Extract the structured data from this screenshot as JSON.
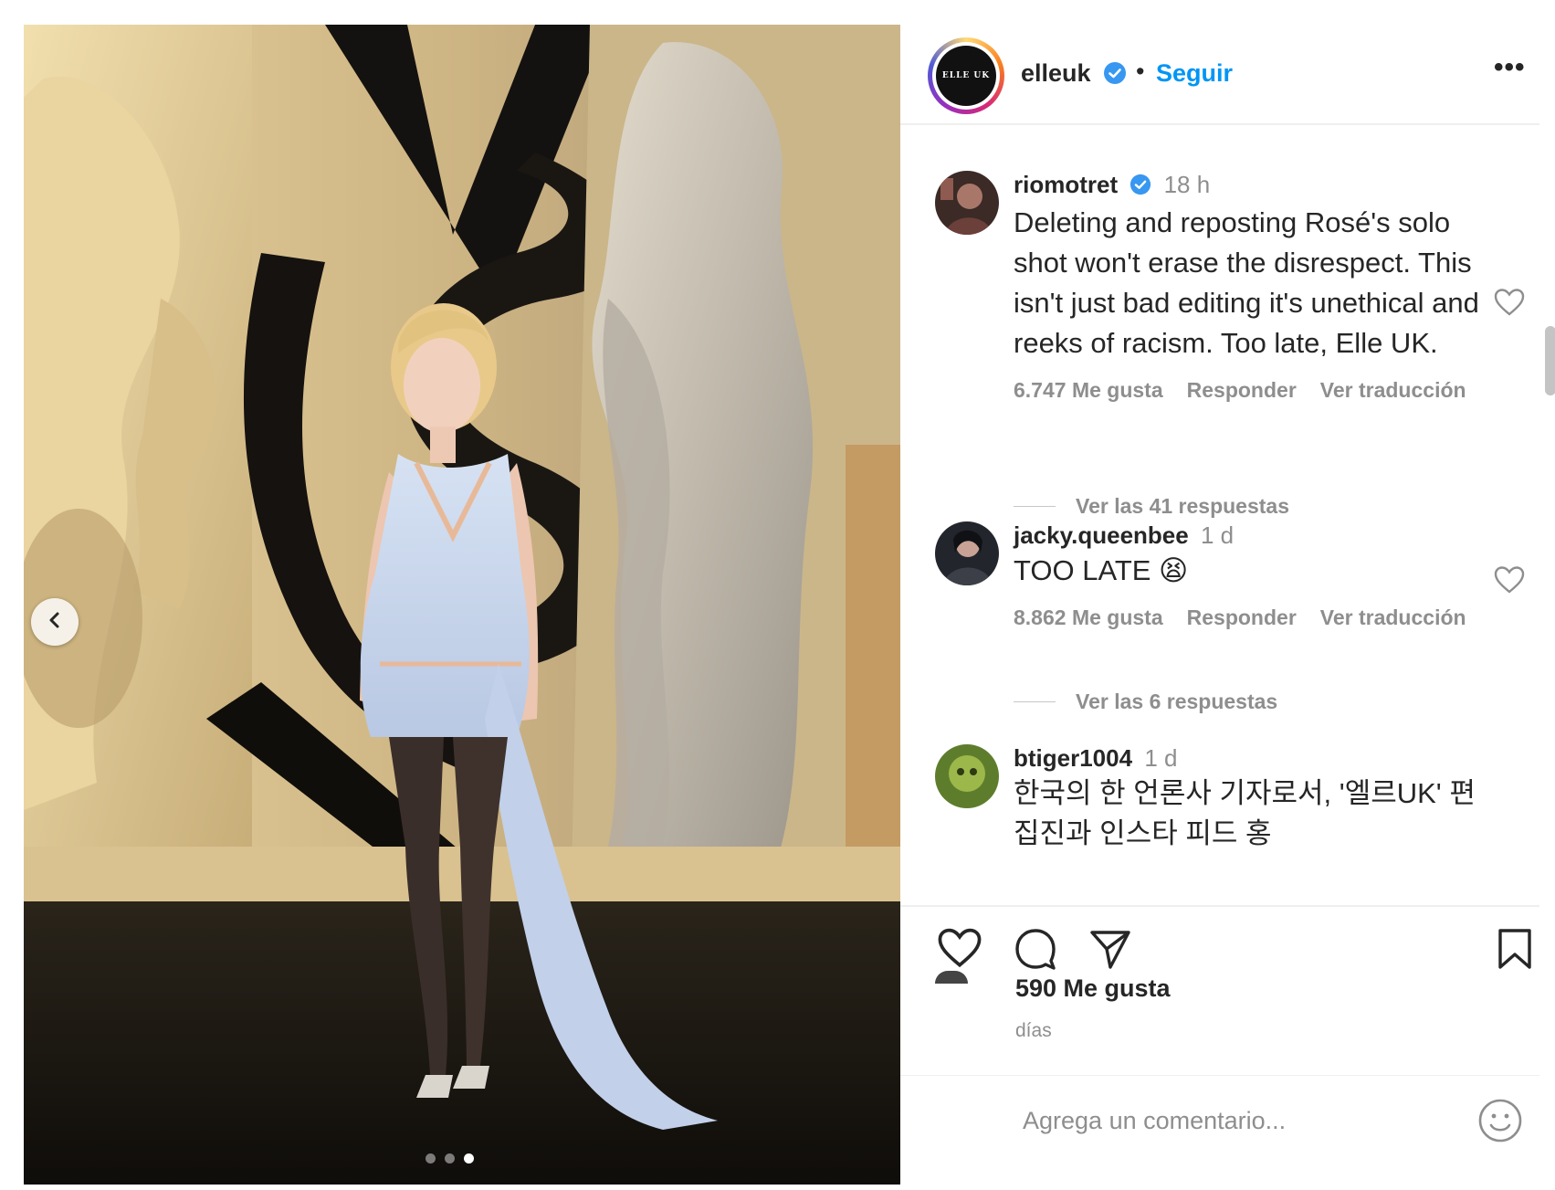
{
  "post": {
    "account": "elleuk",
    "avatar_text": "ELLE UK",
    "separator": "•",
    "follow_label": "Seguir",
    "more_label": "•••",
    "carousel": {
      "slide_count": 3,
      "active_index": 2
    }
  },
  "comments": [
    {
      "username": "riomotret",
      "verified": true,
      "time": "18 h",
      "text": "Deleting and reposting Rosé's solo shot won't erase the disrespect. This isn't just bad editing it's unethical and reeks of racism. Too late, Elle UK.",
      "likes": "6.747 Me gusta",
      "reply_label": "Responder",
      "translate_label": "Ver traducción",
      "view_replies": "Ver las 41 respuestas"
    },
    {
      "username": "jacky.queenbee",
      "verified": false,
      "time": "1 d",
      "text": "TOO LATE 😫",
      "likes": "8.862 Me gusta",
      "reply_label": "Responder",
      "translate_label": "Ver traducción",
      "view_replies": "Ver las 6 respuestas"
    },
    {
      "username": "btiger1004",
      "verified": false,
      "time": "1 d",
      "text": "한국의 한 언론사 기자로서, '엘르UK' 편집진과 인스타 피드 홍"
    }
  ],
  "footer": {
    "likes": "590 Me gusta",
    "date": "días",
    "comment_placeholder": "Agrega un comentario...",
    "icons": [
      "heart-icon",
      "comment-icon",
      "share-icon",
      "bookmark-icon",
      "emoji-icon"
    ]
  },
  "colors": {
    "link_blue": "#0095f6",
    "verified_blue": "#3897f0",
    "text": "#262626",
    "muted": "#8e8e8e"
  }
}
